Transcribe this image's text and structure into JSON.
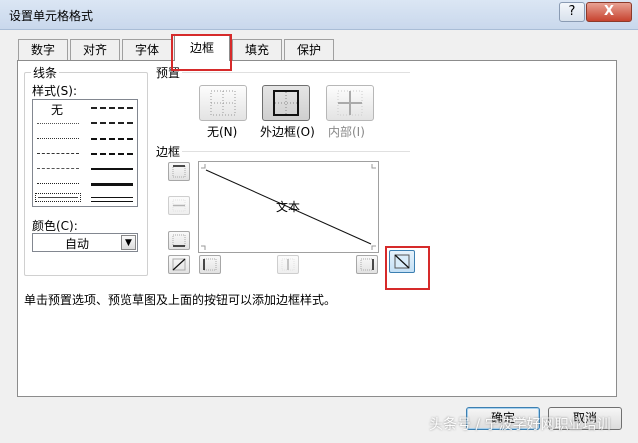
{
  "window": {
    "title": "设置单元格格式",
    "help_label": "?",
    "close_label": "X"
  },
  "tabs": [
    {
      "label": "数字"
    },
    {
      "label": "对齐"
    },
    {
      "label": "字体"
    },
    {
      "label": "边框"
    },
    {
      "label": "填充"
    },
    {
      "label": "保护"
    }
  ],
  "active_tab": "边框",
  "line": {
    "group_label": "线条",
    "style_label": "样式(S):",
    "style_none": "无",
    "color_label": "颜色(C):",
    "color_value": "自动"
  },
  "presets": {
    "label": "预置",
    "items": [
      {
        "label": "无(N)"
      },
      {
        "label": "外边框(O)"
      },
      {
        "label": "内部(I)"
      }
    ]
  },
  "border": {
    "label": "边框",
    "preview_text": "文本"
  },
  "hint": "单击预置选项、预览草图及上面的按钮可以添加边框样式。",
  "buttons": {
    "ok": "确定",
    "cancel": "取消"
  },
  "watermark": "头条号 / 宁波学好网职业培训",
  "colors": {
    "highlight": "#d62a2a",
    "title_bar": "#c9d8ec"
  }
}
